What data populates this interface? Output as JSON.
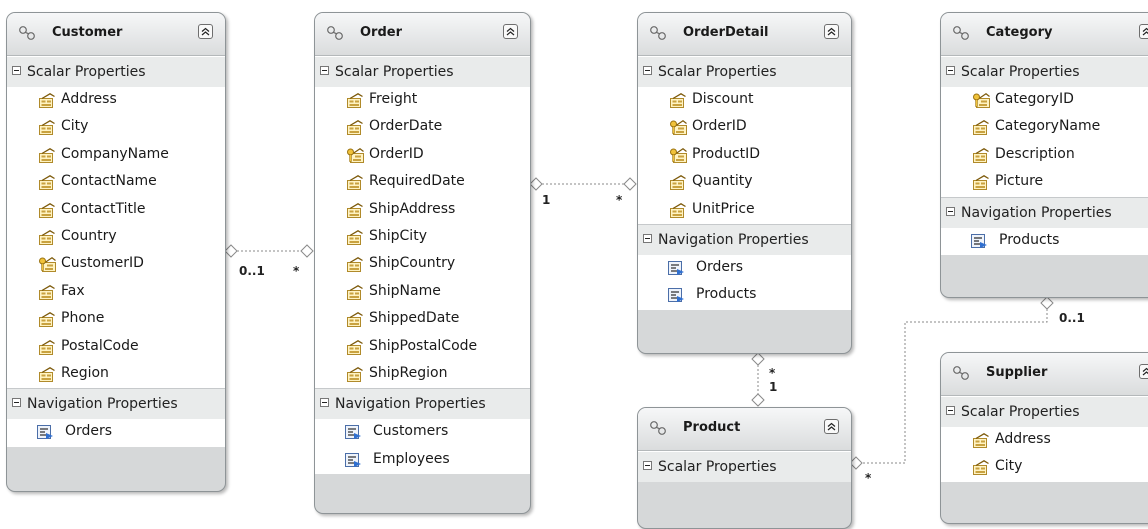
{
  "labels": {
    "scalar": "Scalar Properties",
    "navigation": "Navigation Properties"
  },
  "icons": {
    "entity": "entity-type-icon",
    "property": "property-icon",
    "key_property": "key-property-icon",
    "navigation": "navigation-property-icon",
    "collapse": "collapse-icon"
  },
  "colors": {
    "header_top": "#f6f7f8",
    "header_bottom": "#dadcdd",
    "body_bg": "#d6d8d9",
    "connector": "#8a8a8a"
  },
  "entities": {
    "customer": {
      "name": "Customer",
      "scalar": [
        "Address",
        "City",
        "CompanyName",
        "ContactName",
        "ContactTitle",
        "Country",
        "CustomerID",
        "Fax",
        "Phone",
        "PostalCode",
        "Region"
      ],
      "keys": [
        "CustomerID"
      ],
      "navigation": [
        "Orders"
      ]
    },
    "order": {
      "name": "Order",
      "scalar": [
        "Freight",
        "OrderDate",
        "OrderID",
        "RequiredDate",
        "ShipAddress",
        "ShipCity",
        "ShipCountry",
        "ShipName",
        "ShippedDate",
        "ShipPostalCode",
        "ShipRegion"
      ],
      "keys": [
        "OrderID"
      ],
      "navigation": [
        "Customers",
        "Employees"
      ]
    },
    "orderdetail": {
      "name": "OrderDetail",
      "scalar": [
        "Discount",
        "OrderID",
        "ProductID",
        "Quantity",
        "UnitPrice"
      ],
      "keys": [
        "OrderID",
        "ProductID"
      ],
      "navigation": [
        "Orders",
        "Products"
      ]
    },
    "category": {
      "name": "Category",
      "scalar": [
        "CategoryID",
        "CategoryName",
        "Description",
        "Picture"
      ],
      "keys": [
        "CategoryID"
      ],
      "navigation": [
        "Products"
      ]
    },
    "product": {
      "name": "Product",
      "scalar": [],
      "keys": [],
      "navigation": []
    },
    "supplier": {
      "name": "Supplier",
      "scalar": [
        "Address",
        "City"
      ],
      "keys": [],
      "navigation": []
    }
  },
  "associations": [
    {
      "from": "Customer",
      "to": "Order",
      "from_multiplicity": "0..1",
      "to_multiplicity": "*"
    },
    {
      "from": "Order",
      "to": "OrderDetail",
      "from_multiplicity": "1",
      "to_multiplicity": "*"
    },
    {
      "from": "OrderDetail",
      "to": "Product",
      "from_multiplicity": "*",
      "to_multiplicity": "1"
    },
    {
      "from": "Category",
      "to": "Product",
      "from_multiplicity": "0..1",
      "to_multiplicity": "*"
    }
  ]
}
